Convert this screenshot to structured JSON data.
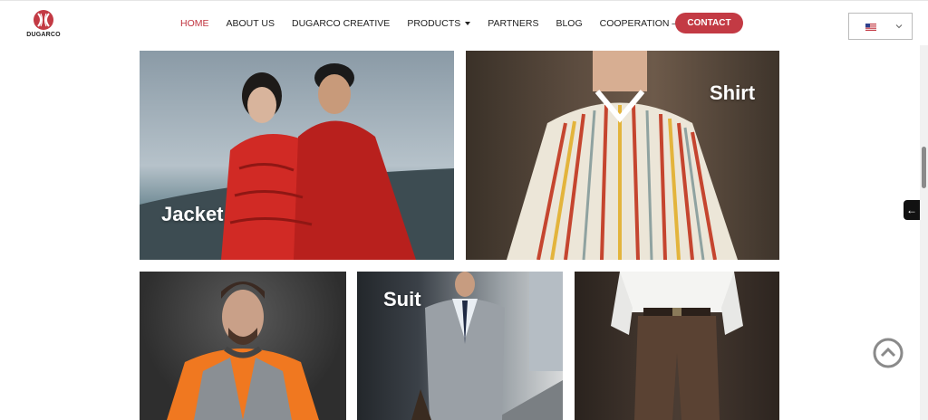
{
  "brand": {
    "name": "DUGARCO",
    "color": "#c0343f"
  },
  "nav": {
    "items": [
      {
        "label": "HOME",
        "active": true
      },
      {
        "label": "ABOUT US"
      },
      {
        "label": "DUGARCO CREATIVE"
      },
      {
        "label": "PRODUCTS",
        "dropdown": true
      },
      {
        "label": "PARTNERS"
      },
      {
        "label": "BLOG"
      },
      {
        "label": "COOPERATION – INVESTMENT"
      }
    ],
    "contact_label": "CONTACT"
  },
  "language": {
    "icon": "us-flag-icon"
  },
  "tiles": {
    "jacket": {
      "label": "Jacket"
    },
    "shirt": {
      "label": "Shirt"
    },
    "suit": {
      "label": "Suit"
    }
  },
  "icons": {
    "side_tab": "←",
    "back_to_top": "chevron-up-circle-icon"
  }
}
